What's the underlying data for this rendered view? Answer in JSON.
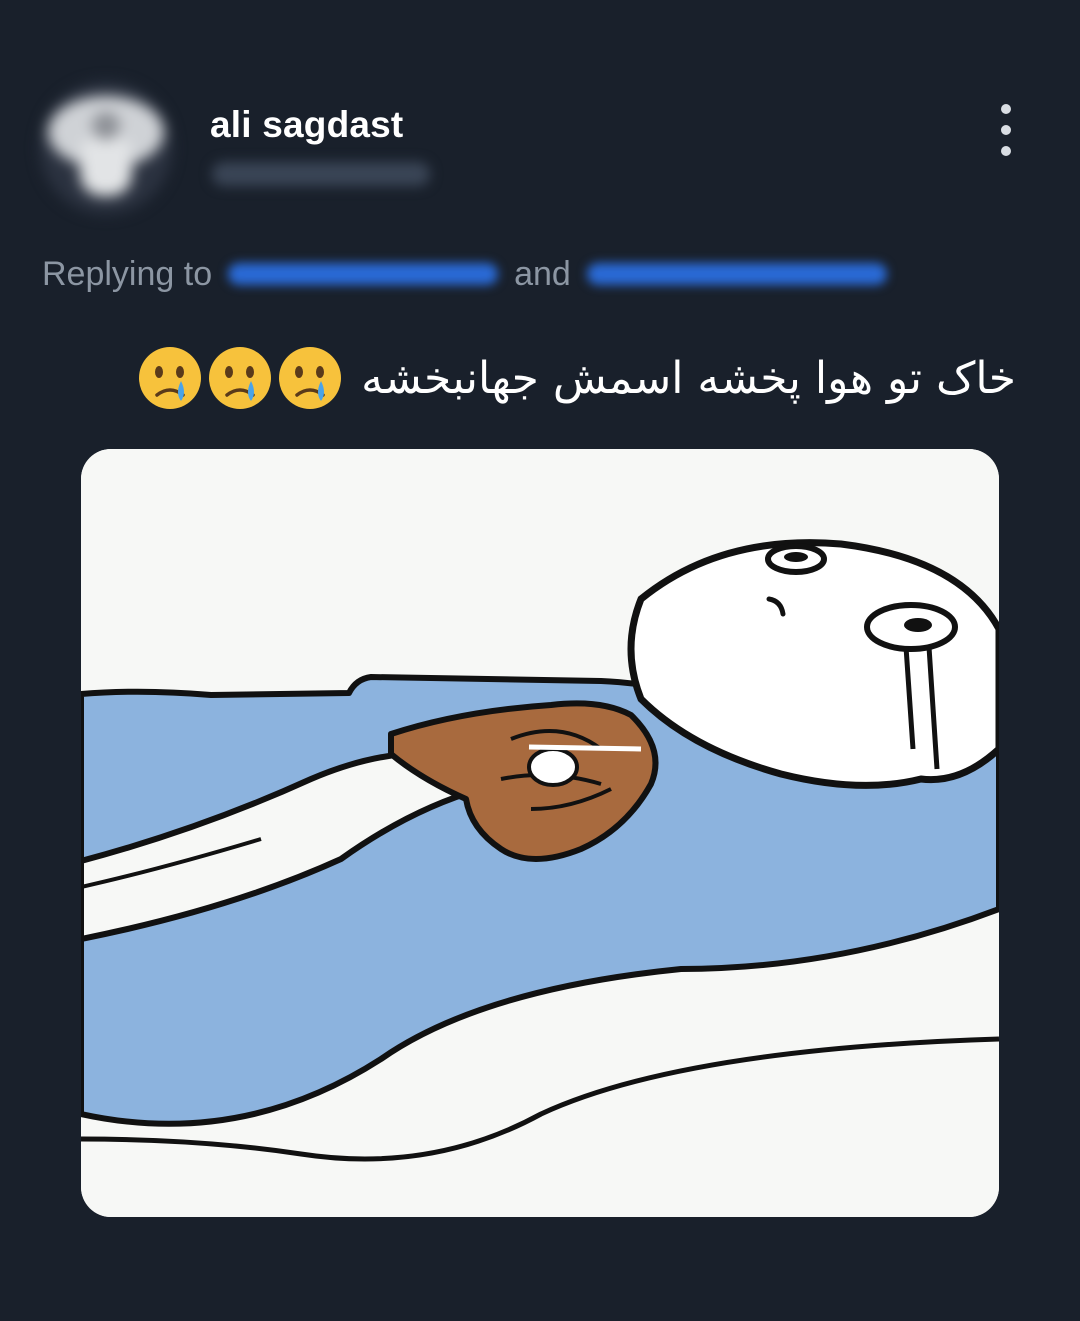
{
  "tweet": {
    "user": {
      "display_name": "ali sagdast",
      "avatar_icon": "avatar-blurred"
    },
    "more_icon": "more-vertical-icon",
    "reply": {
      "prefix": "Replying to",
      "joiner": "and"
    },
    "text": "خاک تو هوا پخشه اسمش جهانبخشه",
    "emojis": [
      "crying-face",
      "crying-face",
      "crying-face"
    ],
    "media": {
      "icon": "cartoon-crying-in-bed-image"
    }
  },
  "colors": {
    "background": "#19202b",
    "text_primary": "#ffffff",
    "text_secondary": "#8c96a3",
    "mention": "#2a6ad6",
    "blanket": "#8cb3de",
    "skin": "#a86a3e"
  }
}
